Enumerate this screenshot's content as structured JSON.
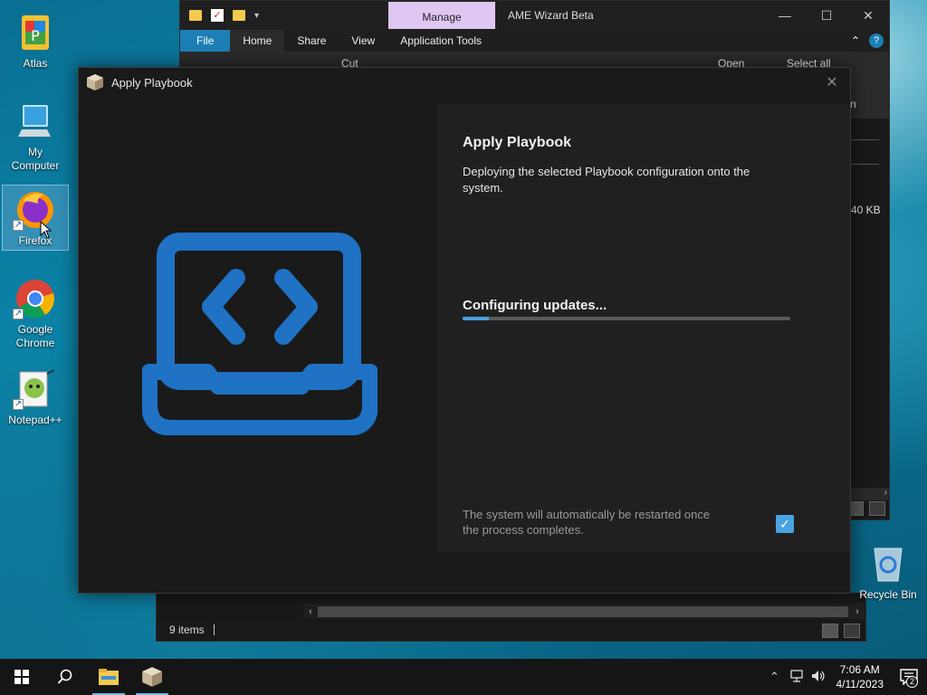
{
  "desktop": {
    "icons": [
      {
        "label": "Atlas",
        "icon": "atlas-icon"
      },
      {
        "label": "My Computer",
        "icon": "computer-icon"
      },
      {
        "label": "Firefox",
        "icon": "firefox-icon"
      },
      {
        "label": "Google Chrome",
        "icon": "chrome-icon"
      },
      {
        "label": "Notepad++",
        "icon": "notepadpp-icon"
      }
    ],
    "recycle_bin_label": "Recycle Bin"
  },
  "explorer": {
    "context_tab": "Manage",
    "title": "AME Wizard Beta",
    "tabs": [
      "File",
      "Home",
      "Share",
      "View",
      "Application Tools"
    ],
    "ribbon": {
      "cut": "Cut",
      "open": "Open",
      "select_all": "Select all"
    },
    "size_fragment": "40 KB",
    "n_fragment": "n",
    "status_items": "9 items"
  },
  "dialog": {
    "title": "Apply Playbook",
    "heading": "Apply Playbook",
    "description": "Deploying the selected Playbook configuration onto the system.",
    "progress_label": "Configuring updates...",
    "progress_fraction": 0.08,
    "restart_note": "The system will automatically be restarted once the process completes.",
    "restart_checked": true,
    "accent": "#4aa3df",
    "illustration": "laptop-code-icon"
  },
  "taskbar": {
    "time": "7:06 AM",
    "date": "4/11/2023",
    "notification_count": "2",
    "pinned": [
      "start-icon",
      "search-icon",
      "file-explorer-icon",
      "ame-wizard-icon"
    ]
  }
}
